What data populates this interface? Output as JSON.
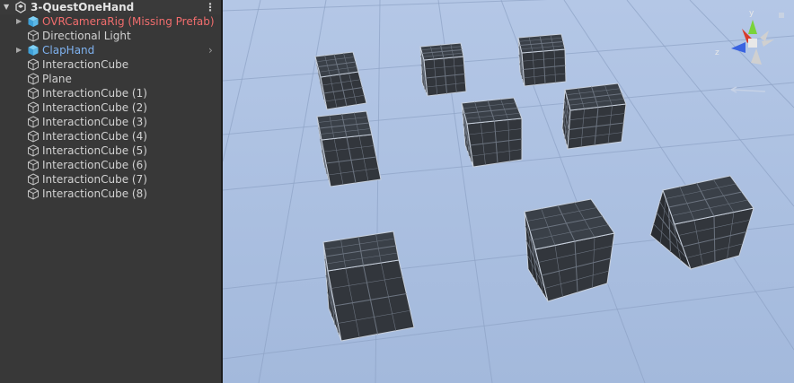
{
  "hierarchy": {
    "scene_name": "3-QuestOneHand",
    "items": [
      {
        "label": "OVRCameraRig (Missing Prefab)",
        "icon": "prefab-cube-icon",
        "state": "missing-prefab",
        "foldout": true
      },
      {
        "label": "Directional Light",
        "icon": "gameobject-cube-icon",
        "state": "normal",
        "foldout": false
      },
      {
        "label": "ClapHand",
        "icon": "prefab-cube-icon",
        "state": "prefab",
        "foldout": true
      },
      {
        "label": "InteractionCube",
        "icon": "gameobject-cube-icon",
        "state": "normal",
        "foldout": false
      },
      {
        "label": "Plane",
        "icon": "gameobject-cube-icon",
        "state": "normal",
        "foldout": false
      },
      {
        "label": "InteractionCube (1)",
        "icon": "gameobject-cube-icon",
        "state": "normal",
        "foldout": false
      },
      {
        "label": "InteractionCube (2)",
        "icon": "gameobject-cube-icon",
        "state": "normal",
        "foldout": false
      },
      {
        "label": "InteractionCube (3)",
        "icon": "gameobject-cube-icon",
        "state": "normal",
        "foldout": false
      },
      {
        "label": "InteractionCube (4)",
        "icon": "gameobject-cube-icon",
        "state": "normal",
        "foldout": false
      },
      {
        "label": "InteractionCube (5)",
        "icon": "gameobject-cube-icon",
        "state": "normal",
        "foldout": false
      },
      {
        "label": "InteractionCube (6)",
        "icon": "gameobject-cube-icon",
        "state": "normal",
        "foldout": false
      },
      {
        "label": "InteractionCube (7)",
        "icon": "gameobject-cube-icon",
        "state": "normal",
        "foldout": false
      },
      {
        "label": "InteractionCube (8)",
        "icon": "gameobject-cube-icon",
        "state": "normal",
        "foldout": false
      }
    ]
  },
  "scene_view": {
    "gizmo": {
      "y_label": "y",
      "z_label": "z"
    }
  },
  "colors": {
    "missing_prefab": "#f06d6d",
    "prefab": "#7fb2f0",
    "panel_bg": "#383838",
    "scene_sky": "#a9bfe1",
    "cube_face": "#2e3238"
  }
}
